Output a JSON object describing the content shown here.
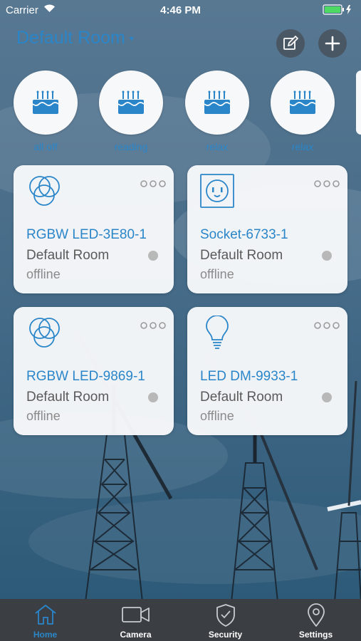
{
  "status_bar": {
    "carrier": "Carrier",
    "time": "4:46 PM"
  },
  "header": {
    "room_title": "Default Room",
    "room_caret": "▾"
  },
  "scenes": [
    {
      "label": "all off"
    },
    {
      "label": "reading"
    },
    {
      "label": "relax"
    },
    {
      "label": "relax"
    }
  ],
  "devices": [
    {
      "name": "RGBW LED-3E80-1",
      "room": "Default Room",
      "status": "offline",
      "icon": "rgb-circles-icon"
    },
    {
      "name": "Socket-6733-1",
      "room": "Default Room",
      "status": "offline",
      "icon": "socket-icon"
    },
    {
      "name": "RGBW LED-9869-1",
      "room": "Default Room",
      "status": "offline",
      "icon": "rgb-circles-icon"
    },
    {
      "name": "LED DM-9933-1",
      "room": "Default Room",
      "status": "offline",
      "icon": "bulb-icon"
    }
  ],
  "tabs": [
    {
      "label": "Home",
      "icon": "home-icon",
      "active": true
    },
    {
      "label": "Camera",
      "icon": "camera-icon",
      "active": false
    },
    {
      "label": "Security",
      "icon": "shield-icon",
      "active": false
    },
    {
      "label": "Settings",
      "icon": "location-pin-icon",
      "active": false
    }
  ],
  "colors": {
    "accent": "#2a86c9",
    "sky_top": "#4f6f8d",
    "sky_bottom": "#2f5f7d",
    "tab_bar": "#3c3e42",
    "battery": "#4cd964"
  }
}
